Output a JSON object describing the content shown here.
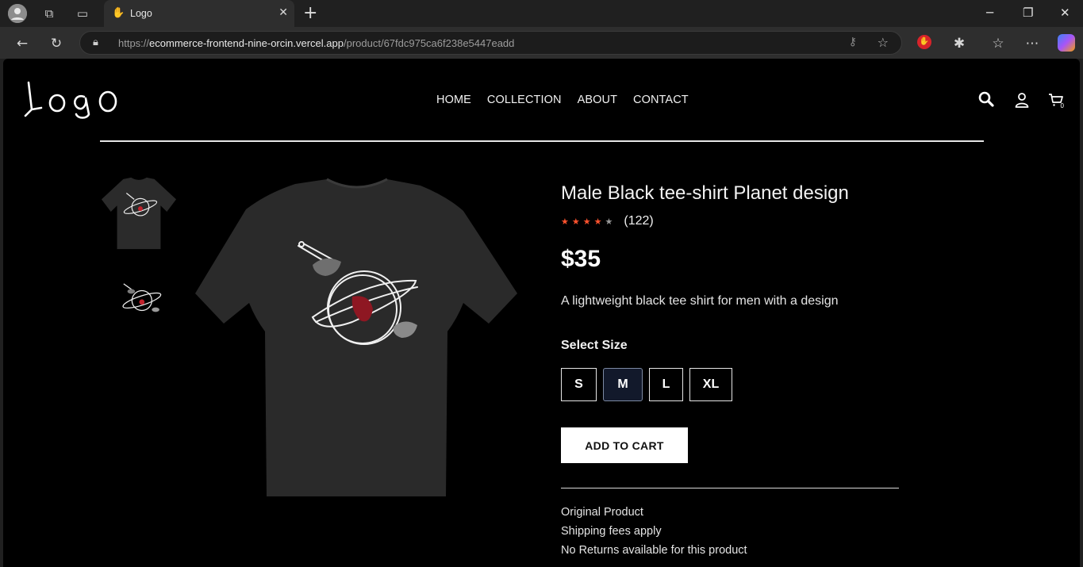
{
  "browser": {
    "tab_title": "Logo",
    "url_scheme": "https://",
    "url_host": "ecommerce-frontend-nine-orcin.vercel.app",
    "url_path": "/product/67fdc975ca6f238e5447eadd"
  },
  "header": {
    "logo_text": "Logo",
    "nav": [
      "HOME",
      "COLLECTION",
      "ABOUT",
      "CONTACT"
    ],
    "cart_count": "0"
  },
  "product": {
    "title": "Male Black tee-shirt Planet design",
    "rating": 4,
    "rating_max": 5,
    "review_count": "(122)",
    "price": "$35",
    "description": "A lightweight black tee shirt for men with a design",
    "size_label": "Select Size",
    "sizes": [
      "S",
      "M",
      "L",
      "XL"
    ],
    "selected_size": "M",
    "add_to_cart": "ADD TO CART",
    "info": [
      "Original Product",
      "Shipping fees apply",
      "No Returns available for this product"
    ]
  },
  "colors": {
    "star_filled": "#ff532e",
    "star_empty": "#9a9a9a",
    "selected_size_bg": "#12192b"
  }
}
